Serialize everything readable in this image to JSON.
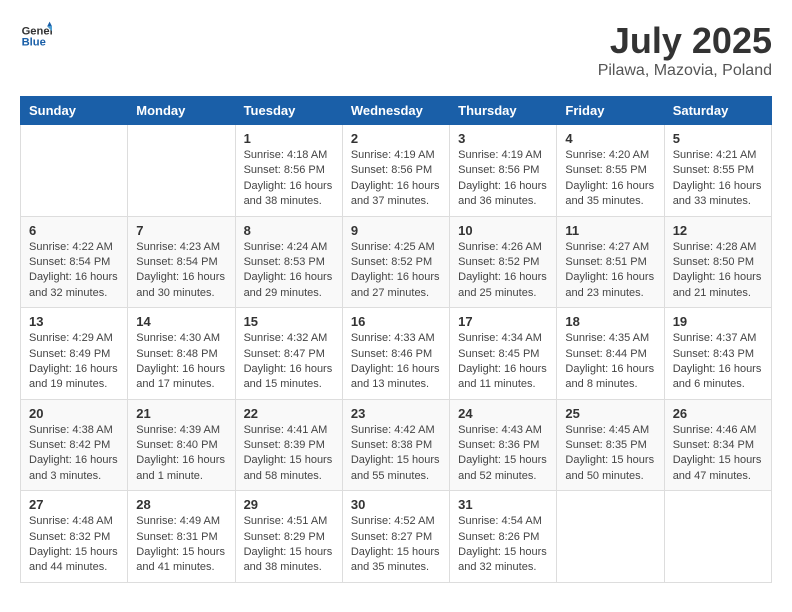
{
  "header": {
    "logo_general": "General",
    "logo_blue": "Blue",
    "month_year": "July 2025",
    "location": "Pilawa, Mazovia, Poland"
  },
  "calendar": {
    "weekdays": [
      "Sunday",
      "Monday",
      "Tuesday",
      "Wednesday",
      "Thursday",
      "Friday",
      "Saturday"
    ],
    "weeks": [
      [
        {
          "day": "",
          "sunrise": "",
          "sunset": "",
          "daylight": ""
        },
        {
          "day": "",
          "sunrise": "",
          "sunset": "",
          "daylight": ""
        },
        {
          "day": "1",
          "sunrise": "Sunrise: 4:18 AM",
          "sunset": "Sunset: 8:56 PM",
          "daylight": "Daylight: 16 hours and 38 minutes."
        },
        {
          "day": "2",
          "sunrise": "Sunrise: 4:19 AM",
          "sunset": "Sunset: 8:56 PM",
          "daylight": "Daylight: 16 hours and 37 minutes."
        },
        {
          "day": "3",
          "sunrise": "Sunrise: 4:19 AM",
          "sunset": "Sunset: 8:56 PM",
          "daylight": "Daylight: 16 hours and 36 minutes."
        },
        {
          "day": "4",
          "sunrise": "Sunrise: 4:20 AM",
          "sunset": "Sunset: 8:55 PM",
          "daylight": "Daylight: 16 hours and 35 minutes."
        },
        {
          "day": "5",
          "sunrise": "Sunrise: 4:21 AM",
          "sunset": "Sunset: 8:55 PM",
          "daylight": "Daylight: 16 hours and 33 minutes."
        }
      ],
      [
        {
          "day": "6",
          "sunrise": "Sunrise: 4:22 AM",
          "sunset": "Sunset: 8:54 PM",
          "daylight": "Daylight: 16 hours and 32 minutes."
        },
        {
          "day": "7",
          "sunrise": "Sunrise: 4:23 AM",
          "sunset": "Sunset: 8:54 PM",
          "daylight": "Daylight: 16 hours and 30 minutes."
        },
        {
          "day": "8",
          "sunrise": "Sunrise: 4:24 AM",
          "sunset": "Sunset: 8:53 PM",
          "daylight": "Daylight: 16 hours and 29 minutes."
        },
        {
          "day": "9",
          "sunrise": "Sunrise: 4:25 AM",
          "sunset": "Sunset: 8:52 PM",
          "daylight": "Daylight: 16 hours and 27 minutes."
        },
        {
          "day": "10",
          "sunrise": "Sunrise: 4:26 AM",
          "sunset": "Sunset: 8:52 PM",
          "daylight": "Daylight: 16 hours and 25 minutes."
        },
        {
          "day": "11",
          "sunrise": "Sunrise: 4:27 AM",
          "sunset": "Sunset: 8:51 PM",
          "daylight": "Daylight: 16 hours and 23 minutes."
        },
        {
          "day": "12",
          "sunrise": "Sunrise: 4:28 AM",
          "sunset": "Sunset: 8:50 PM",
          "daylight": "Daylight: 16 hours and 21 minutes."
        }
      ],
      [
        {
          "day": "13",
          "sunrise": "Sunrise: 4:29 AM",
          "sunset": "Sunset: 8:49 PM",
          "daylight": "Daylight: 16 hours and 19 minutes."
        },
        {
          "day": "14",
          "sunrise": "Sunrise: 4:30 AM",
          "sunset": "Sunset: 8:48 PM",
          "daylight": "Daylight: 16 hours and 17 minutes."
        },
        {
          "day": "15",
          "sunrise": "Sunrise: 4:32 AM",
          "sunset": "Sunset: 8:47 PM",
          "daylight": "Daylight: 16 hours and 15 minutes."
        },
        {
          "day": "16",
          "sunrise": "Sunrise: 4:33 AM",
          "sunset": "Sunset: 8:46 PM",
          "daylight": "Daylight: 16 hours and 13 minutes."
        },
        {
          "day": "17",
          "sunrise": "Sunrise: 4:34 AM",
          "sunset": "Sunset: 8:45 PM",
          "daylight": "Daylight: 16 hours and 11 minutes."
        },
        {
          "day": "18",
          "sunrise": "Sunrise: 4:35 AM",
          "sunset": "Sunset: 8:44 PM",
          "daylight": "Daylight: 16 hours and 8 minutes."
        },
        {
          "day": "19",
          "sunrise": "Sunrise: 4:37 AM",
          "sunset": "Sunset: 8:43 PM",
          "daylight": "Daylight: 16 hours and 6 minutes."
        }
      ],
      [
        {
          "day": "20",
          "sunrise": "Sunrise: 4:38 AM",
          "sunset": "Sunset: 8:42 PM",
          "daylight": "Daylight: 16 hours and 3 minutes."
        },
        {
          "day": "21",
          "sunrise": "Sunrise: 4:39 AM",
          "sunset": "Sunset: 8:40 PM",
          "daylight": "Daylight: 16 hours and 1 minute."
        },
        {
          "day": "22",
          "sunrise": "Sunrise: 4:41 AM",
          "sunset": "Sunset: 8:39 PM",
          "daylight": "Daylight: 15 hours and 58 minutes."
        },
        {
          "day": "23",
          "sunrise": "Sunrise: 4:42 AM",
          "sunset": "Sunset: 8:38 PM",
          "daylight": "Daylight: 15 hours and 55 minutes."
        },
        {
          "day": "24",
          "sunrise": "Sunrise: 4:43 AM",
          "sunset": "Sunset: 8:36 PM",
          "daylight": "Daylight: 15 hours and 52 minutes."
        },
        {
          "day": "25",
          "sunrise": "Sunrise: 4:45 AM",
          "sunset": "Sunset: 8:35 PM",
          "daylight": "Daylight: 15 hours and 50 minutes."
        },
        {
          "day": "26",
          "sunrise": "Sunrise: 4:46 AM",
          "sunset": "Sunset: 8:34 PM",
          "daylight": "Daylight: 15 hours and 47 minutes."
        }
      ],
      [
        {
          "day": "27",
          "sunrise": "Sunrise: 4:48 AM",
          "sunset": "Sunset: 8:32 PM",
          "daylight": "Daylight: 15 hours and 44 minutes."
        },
        {
          "day": "28",
          "sunrise": "Sunrise: 4:49 AM",
          "sunset": "Sunset: 8:31 PM",
          "daylight": "Daylight: 15 hours and 41 minutes."
        },
        {
          "day": "29",
          "sunrise": "Sunrise: 4:51 AM",
          "sunset": "Sunset: 8:29 PM",
          "daylight": "Daylight: 15 hours and 38 minutes."
        },
        {
          "day": "30",
          "sunrise": "Sunrise: 4:52 AM",
          "sunset": "Sunset: 8:27 PM",
          "daylight": "Daylight: 15 hours and 35 minutes."
        },
        {
          "day": "31",
          "sunrise": "Sunrise: 4:54 AM",
          "sunset": "Sunset: 8:26 PM",
          "daylight": "Daylight: 15 hours and 32 minutes."
        },
        {
          "day": "",
          "sunrise": "",
          "sunset": "",
          "daylight": ""
        },
        {
          "day": "",
          "sunrise": "",
          "sunset": "",
          "daylight": ""
        }
      ]
    ]
  }
}
